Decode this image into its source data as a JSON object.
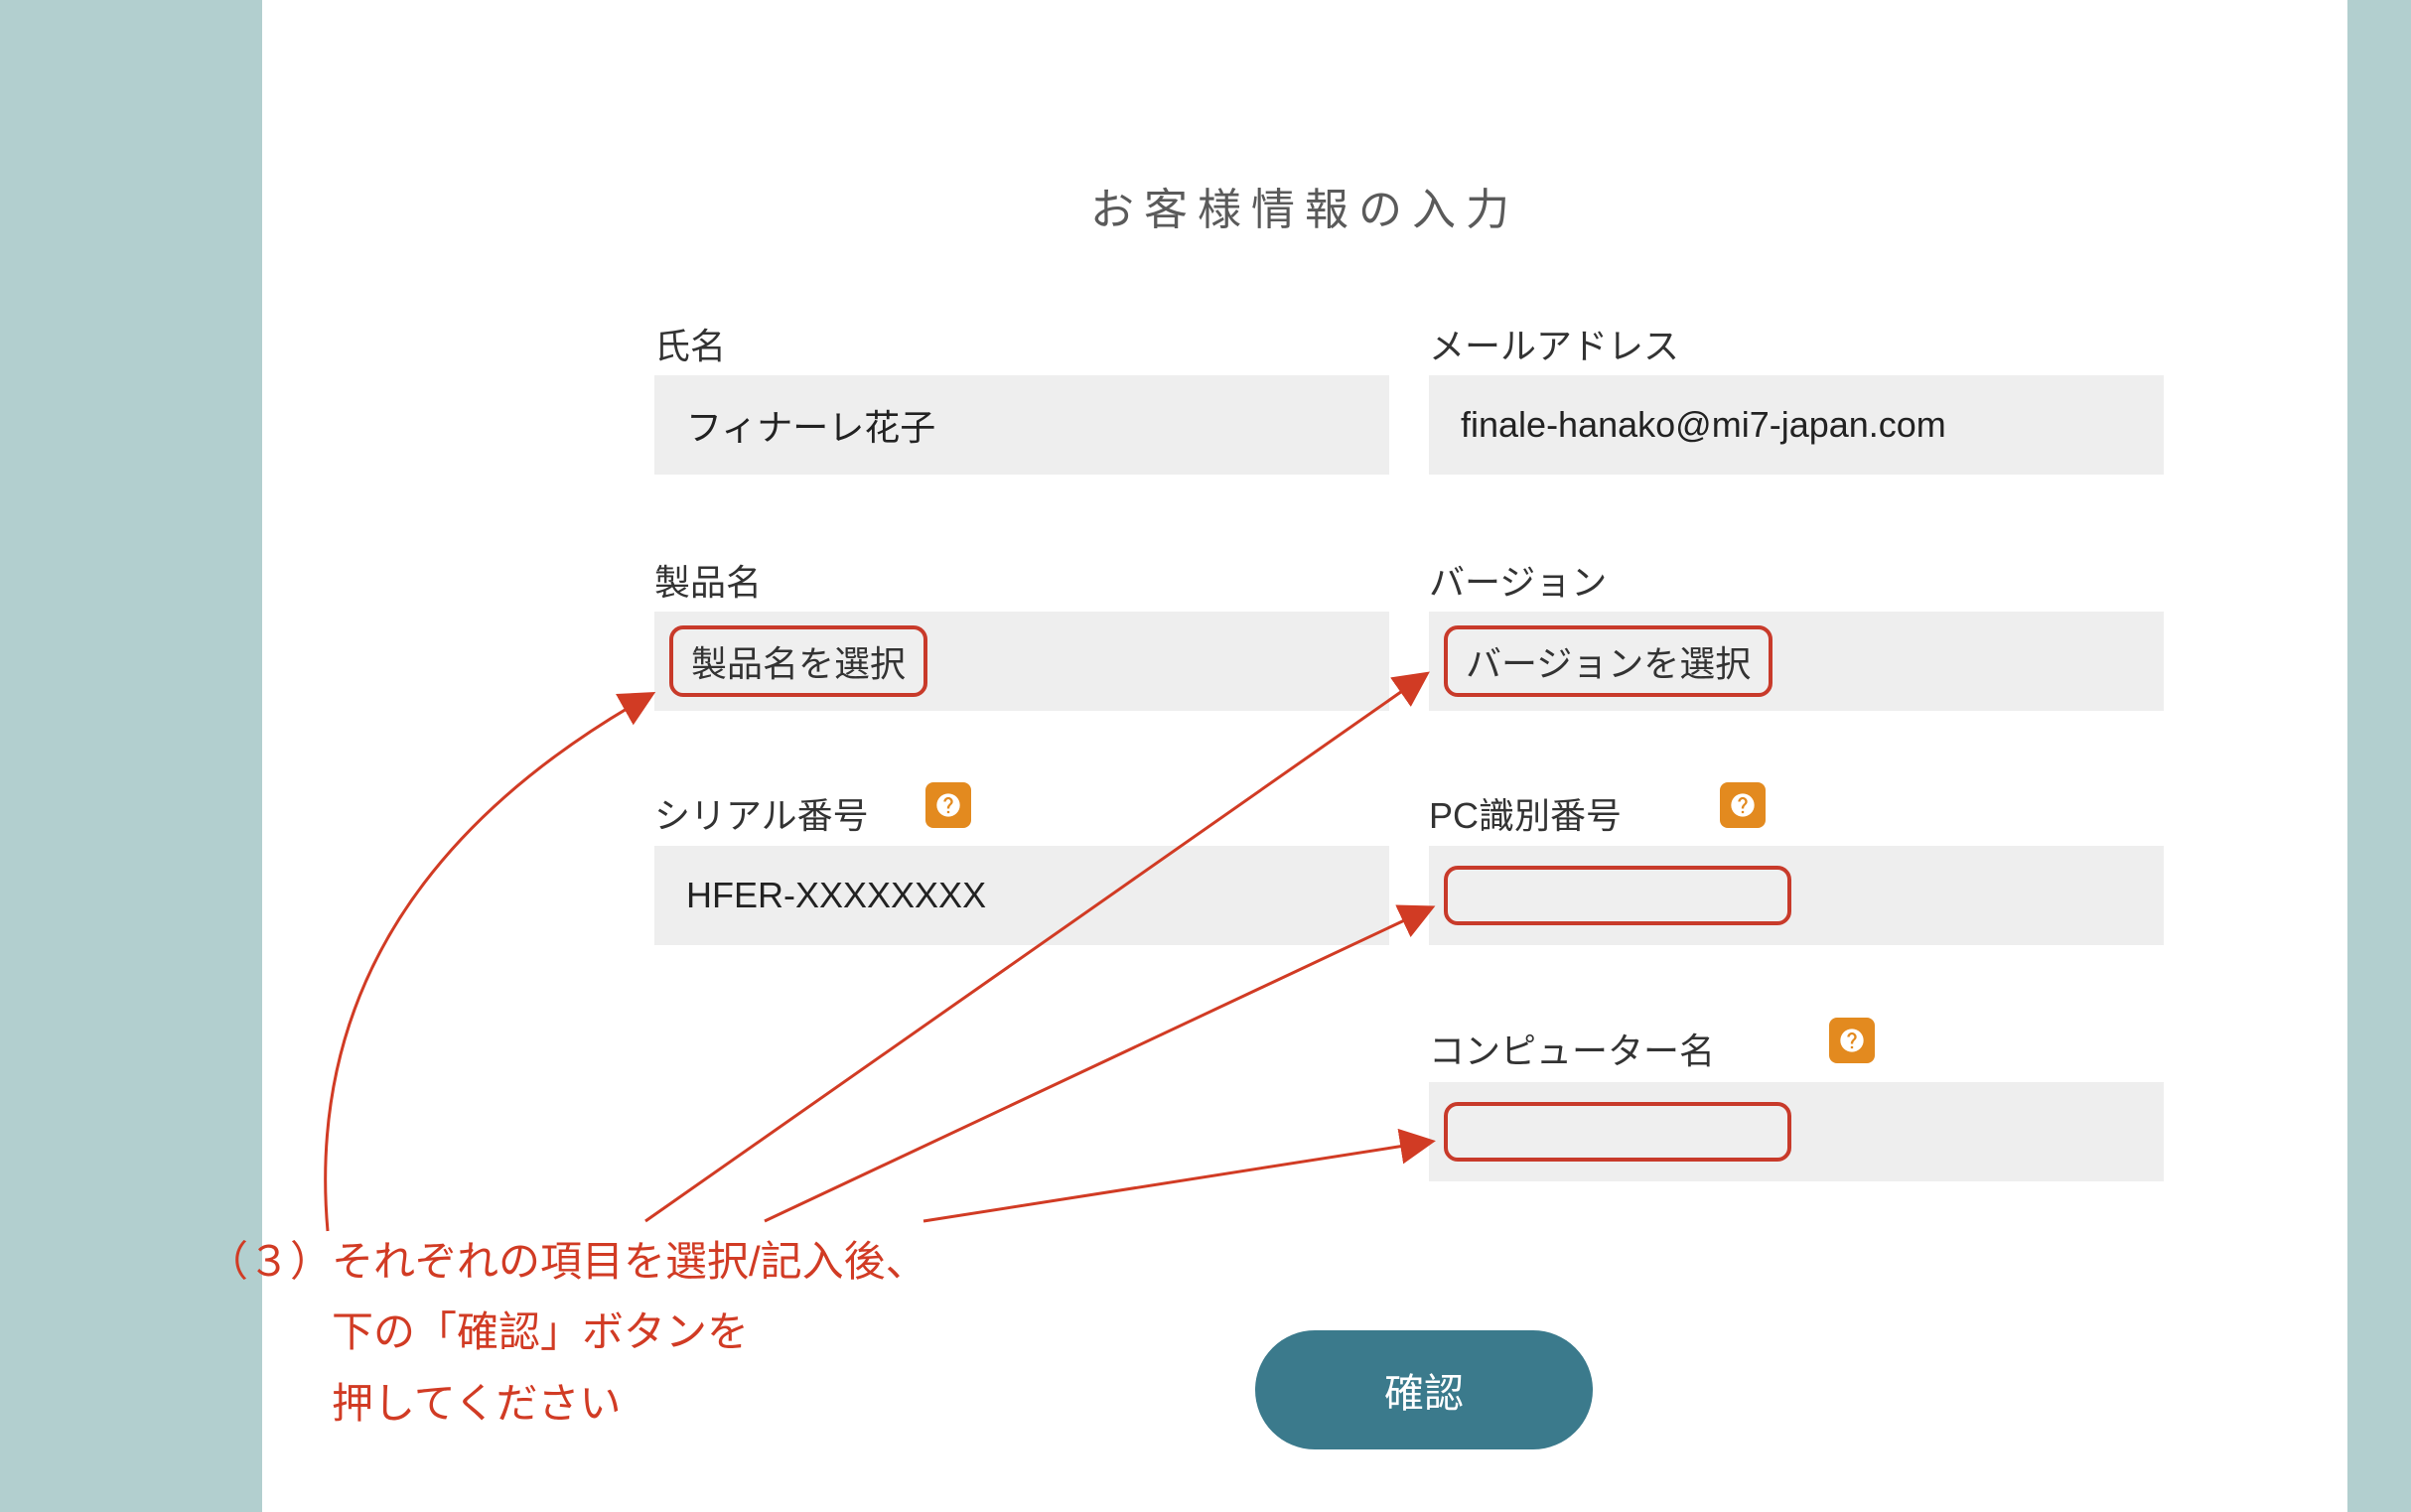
{
  "title": "お客様情報の入力",
  "labels": {
    "name": "氏名",
    "email": "メールアドレス",
    "product": "製品名",
    "version": "バージョン",
    "serial": "シリアル番号",
    "pcid": "PC識別番号",
    "compname": "コンピューター名"
  },
  "values": {
    "name": "フィナーレ花子",
    "email": "finale-hanako@mi7-japan.com",
    "serial": "HFER-XXXXXXXX",
    "pcid": "",
    "compname": ""
  },
  "placeholders": {
    "product": "製品名を選択",
    "version": "バージョンを選択"
  },
  "buttons": {
    "submit": "確認"
  },
  "annotation": {
    "line1": "（３）それぞれの項目を選択/記入後、",
    "line2": "　　　下の「確認」ボタンを",
    "line3": "　　　押してください"
  }
}
